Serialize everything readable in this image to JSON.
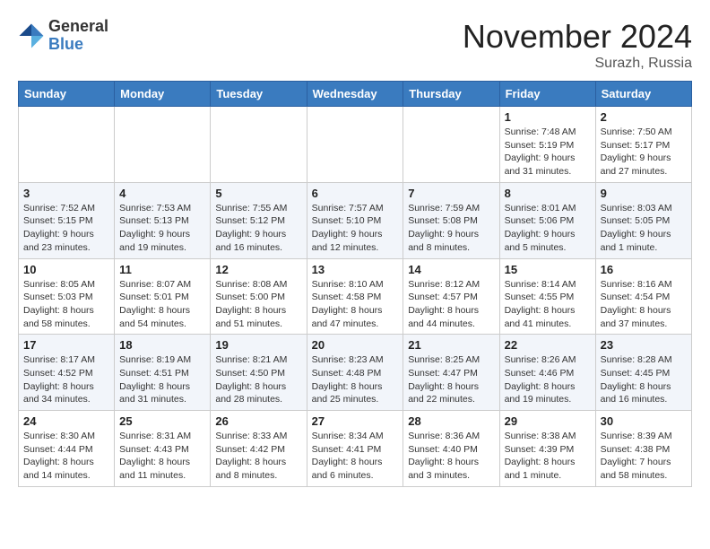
{
  "header": {
    "logo_general": "General",
    "logo_blue": "Blue",
    "month_title": "November 2024",
    "location": "Surazh, Russia"
  },
  "weekdays": [
    "Sunday",
    "Monday",
    "Tuesday",
    "Wednesday",
    "Thursday",
    "Friday",
    "Saturday"
  ],
  "weeks": [
    [
      {
        "day": "",
        "info": ""
      },
      {
        "day": "",
        "info": ""
      },
      {
        "day": "",
        "info": ""
      },
      {
        "day": "",
        "info": ""
      },
      {
        "day": "",
        "info": ""
      },
      {
        "day": "1",
        "info": "Sunrise: 7:48 AM\nSunset: 5:19 PM\nDaylight: 9 hours and 31 minutes."
      },
      {
        "day": "2",
        "info": "Sunrise: 7:50 AM\nSunset: 5:17 PM\nDaylight: 9 hours and 27 minutes."
      }
    ],
    [
      {
        "day": "3",
        "info": "Sunrise: 7:52 AM\nSunset: 5:15 PM\nDaylight: 9 hours and 23 minutes."
      },
      {
        "day": "4",
        "info": "Sunrise: 7:53 AM\nSunset: 5:13 PM\nDaylight: 9 hours and 19 minutes."
      },
      {
        "day": "5",
        "info": "Sunrise: 7:55 AM\nSunset: 5:12 PM\nDaylight: 9 hours and 16 minutes."
      },
      {
        "day": "6",
        "info": "Sunrise: 7:57 AM\nSunset: 5:10 PM\nDaylight: 9 hours and 12 minutes."
      },
      {
        "day": "7",
        "info": "Sunrise: 7:59 AM\nSunset: 5:08 PM\nDaylight: 9 hours and 8 minutes."
      },
      {
        "day": "8",
        "info": "Sunrise: 8:01 AM\nSunset: 5:06 PM\nDaylight: 9 hours and 5 minutes."
      },
      {
        "day": "9",
        "info": "Sunrise: 8:03 AM\nSunset: 5:05 PM\nDaylight: 9 hours and 1 minute."
      }
    ],
    [
      {
        "day": "10",
        "info": "Sunrise: 8:05 AM\nSunset: 5:03 PM\nDaylight: 8 hours and 58 minutes."
      },
      {
        "day": "11",
        "info": "Sunrise: 8:07 AM\nSunset: 5:01 PM\nDaylight: 8 hours and 54 minutes."
      },
      {
        "day": "12",
        "info": "Sunrise: 8:08 AM\nSunset: 5:00 PM\nDaylight: 8 hours and 51 minutes."
      },
      {
        "day": "13",
        "info": "Sunrise: 8:10 AM\nSunset: 4:58 PM\nDaylight: 8 hours and 47 minutes."
      },
      {
        "day": "14",
        "info": "Sunrise: 8:12 AM\nSunset: 4:57 PM\nDaylight: 8 hours and 44 minutes."
      },
      {
        "day": "15",
        "info": "Sunrise: 8:14 AM\nSunset: 4:55 PM\nDaylight: 8 hours and 41 minutes."
      },
      {
        "day": "16",
        "info": "Sunrise: 8:16 AM\nSunset: 4:54 PM\nDaylight: 8 hours and 37 minutes."
      }
    ],
    [
      {
        "day": "17",
        "info": "Sunrise: 8:17 AM\nSunset: 4:52 PM\nDaylight: 8 hours and 34 minutes."
      },
      {
        "day": "18",
        "info": "Sunrise: 8:19 AM\nSunset: 4:51 PM\nDaylight: 8 hours and 31 minutes."
      },
      {
        "day": "19",
        "info": "Sunrise: 8:21 AM\nSunset: 4:50 PM\nDaylight: 8 hours and 28 minutes."
      },
      {
        "day": "20",
        "info": "Sunrise: 8:23 AM\nSunset: 4:48 PM\nDaylight: 8 hours and 25 minutes."
      },
      {
        "day": "21",
        "info": "Sunrise: 8:25 AM\nSunset: 4:47 PM\nDaylight: 8 hours and 22 minutes."
      },
      {
        "day": "22",
        "info": "Sunrise: 8:26 AM\nSunset: 4:46 PM\nDaylight: 8 hours and 19 minutes."
      },
      {
        "day": "23",
        "info": "Sunrise: 8:28 AM\nSunset: 4:45 PM\nDaylight: 8 hours and 16 minutes."
      }
    ],
    [
      {
        "day": "24",
        "info": "Sunrise: 8:30 AM\nSunset: 4:44 PM\nDaylight: 8 hours and 14 minutes."
      },
      {
        "day": "25",
        "info": "Sunrise: 8:31 AM\nSunset: 4:43 PM\nDaylight: 8 hours and 11 minutes."
      },
      {
        "day": "26",
        "info": "Sunrise: 8:33 AM\nSunset: 4:42 PM\nDaylight: 8 hours and 8 minutes."
      },
      {
        "day": "27",
        "info": "Sunrise: 8:34 AM\nSunset: 4:41 PM\nDaylight: 8 hours and 6 minutes."
      },
      {
        "day": "28",
        "info": "Sunrise: 8:36 AM\nSunset: 4:40 PM\nDaylight: 8 hours and 3 minutes."
      },
      {
        "day": "29",
        "info": "Sunrise: 8:38 AM\nSunset: 4:39 PM\nDaylight: 8 hours and 1 minute."
      },
      {
        "day": "30",
        "info": "Sunrise: 8:39 AM\nSunset: 4:38 PM\nDaylight: 7 hours and 58 minutes."
      }
    ]
  ]
}
